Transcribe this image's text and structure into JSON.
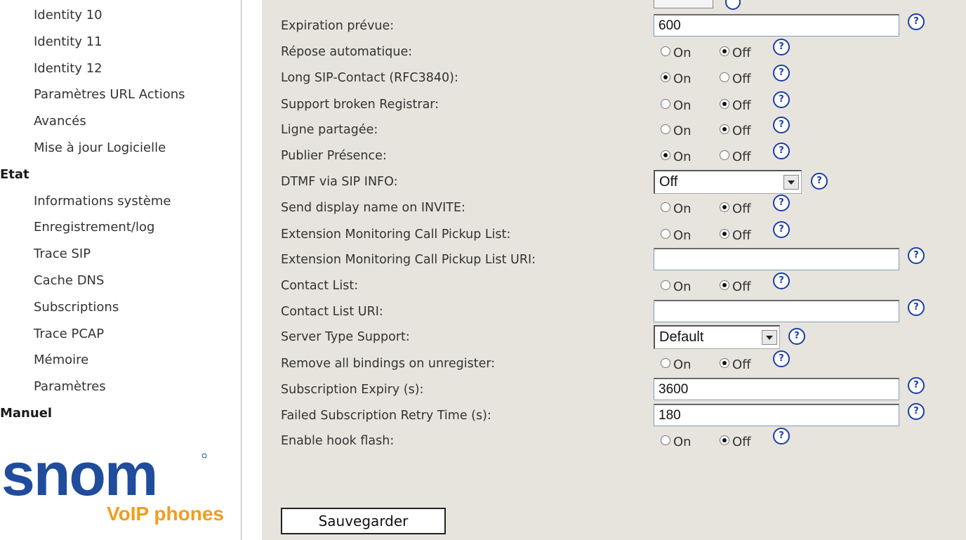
{
  "sidebar": {
    "items": [
      {
        "label": "Identity 10",
        "type": "sub"
      },
      {
        "label": "Identity 11",
        "type": "sub"
      },
      {
        "label": "Identity 12",
        "type": "sub"
      },
      {
        "label": "Paramètres URL Actions",
        "type": "sub"
      },
      {
        "label": "Avancés",
        "type": "sub"
      },
      {
        "label": "Mise à jour Logicielle",
        "type": "sub"
      },
      {
        "label": "Etat",
        "type": "head"
      },
      {
        "label": "Informations système",
        "type": "sub"
      },
      {
        "label": "Enregistrement/log",
        "type": "sub"
      },
      {
        "label": "Trace SIP",
        "type": "sub"
      },
      {
        "label": "Cache DNS",
        "type": "sub"
      },
      {
        "label": "Subscriptions",
        "type": "sub"
      },
      {
        "label": "Trace PCAP",
        "type": "sub"
      },
      {
        "label": "Mémoire",
        "type": "sub"
      },
      {
        "label": "Paramètres",
        "type": "sub"
      },
      {
        "label": "Manuel",
        "type": "head"
      }
    ],
    "logo": {
      "brand": "snom",
      "tagline": "VoIP phones",
      "brand_color": "#1f4c9c",
      "tagline_color": "#f39c1e"
    }
  },
  "form": {
    "on_label": "On",
    "off_label": "Off",
    "help_glyph": "?",
    "rows": [
      {
        "label": "Expiration prévue:",
        "kind": "text",
        "value": "600"
      },
      {
        "label": "Répose automatique:",
        "kind": "radio",
        "selected": "off"
      },
      {
        "label": "Long SIP-Contact (RFC3840):",
        "kind": "radio",
        "selected": "on"
      },
      {
        "label": "Support broken Registrar:",
        "kind": "radio",
        "selected": "off"
      },
      {
        "label": "Ligne partagée:",
        "kind": "radio",
        "selected": "off"
      },
      {
        "label": "Publier Présence:",
        "kind": "radio",
        "selected": "on"
      },
      {
        "label": "DTMF via SIP INFO:",
        "kind": "select",
        "value": "Off"
      },
      {
        "label": "Send display name on INVITE:",
        "kind": "radio",
        "selected": "off"
      },
      {
        "label": "Extension Monitoring Call Pickup List:",
        "kind": "radio",
        "selected": "off"
      },
      {
        "label": "Extension Monitoring Call Pickup List URI:",
        "kind": "text",
        "value": ""
      },
      {
        "label": "Contact List:",
        "kind": "radio",
        "selected": "off"
      },
      {
        "label": "Contact List URI:",
        "kind": "text",
        "value": ""
      },
      {
        "label": "Server Type Support:",
        "kind": "select",
        "value": "Default"
      },
      {
        "label": "Remove all bindings on unregister:",
        "kind": "radio",
        "selected": "off"
      },
      {
        "label": "Subscription Expiry (s):",
        "kind": "text",
        "value": "3600"
      },
      {
        "label": "Failed Subscription Retry Time (s):",
        "kind": "text",
        "value": "180"
      },
      {
        "label": "Enable hook flash:",
        "kind": "radio",
        "selected": "off"
      }
    ],
    "save_label": "Sauvegarder"
  }
}
